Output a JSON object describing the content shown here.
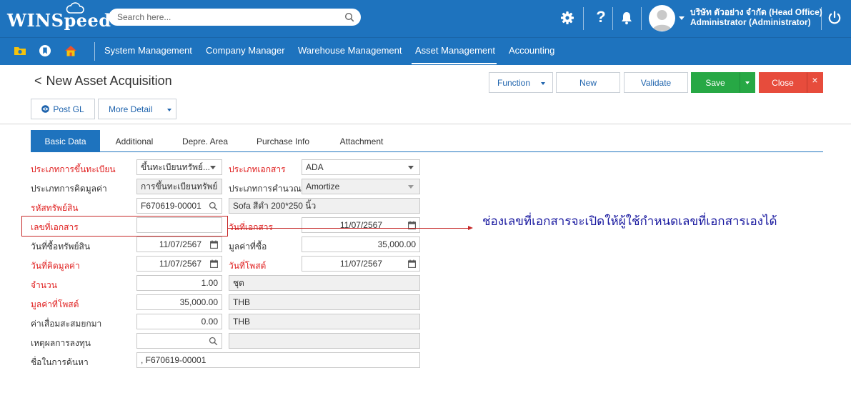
{
  "brand": {
    "logo_text": "WINSpeed",
    "accent": "#1e73be"
  },
  "search": {
    "placeholder": "Search here..."
  },
  "topbar": {
    "icons": [
      "gear-icon",
      "help-icon",
      "bell-icon",
      "user-avatar",
      "power-icon"
    ],
    "help_glyph": "?",
    "company": "บริษัท ตัวอย่าง จำกัด (Head Office)",
    "user": "Administrator (Administrator)"
  },
  "nav": {
    "icons": [
      "folder-icon",
      "bookmark-icon",
      "home-icon"
    ],
    "items": [
      "System Management",
      "Company Manager",
      "Warehouse Management",
      "Asset Management",
      "Accounting"
    ],
    "active": "Asset Management"
  },
  "page": {
    "back_glyph": "<",
    "title": "New Asset Acquisition",
    "buttons": {
      "function": "Function",
      "new": "New",
      "validate": "Validate",
      "save": "Save",
      "close": "Close",
      "close_x": "×",
      "post_gl": "Post GL",
      "more_detail": "More Detail"
    },
    "colors": {
      "save": "#27a845",
      "close": "#e74c3c"
    }
  },
  "tabs": [
    "Basic Data",
    "Additional",
    "Depre. Area",
    "Purchase Info",
    "Attachment"
  ],
  "active_tab": "Basic Data",
  "form": {
    "reg_type": {
      "label": "ประเภทการขึ้นทะเบียน",
      "value": "ขึ้นทะเบียนทรัพย์..."
    },
    "doc_type": {
      "label": "ประเภทเอกสาร",
      "value": "ADA"
    },
    "calc_type": {
      "label": "ประเภทการคิดมูลค่า",
      "value": "การขึ้นทะเบียนทรัพย์สิ"
    },
    "compute_type": {
      "label": "ประเภทการคำนวณ",
      "value": "Amortize"
    },
    "asset_code": {
      "label": "รหัสทรัพย์สิน",
      "value": "F670619-00001"
    },
    "asset_name": {
      "value": "Sofa สีดำ 200*250 นิ้ว"
    },
    "doc_no": {
      "label": "เลขที่เอกสาร",
      "value": ""
    },
    "doc_date": {
      "label": "วันที่เอกสาร",
      "value": "11/07/2567"
    },
    "purchase_date": {
      "label": "วันที่ซื้อทรัพย์สิน",
      "value": "11/07/2567"
    },
    "purchase_value": {
      "label": "มูลค่าที่ซื้อ",
      "value": "35,000.00"
    },
    "calc_date": {
      "label": "วันที่คิดมูลค่า",
      "value": "11/07/2567"
    },
    "post_date": {
      "label": "วันที่โพสต์",
      "value": "11/07/2567"
    },
    "quantity": {
      "label": "จำนวน",
      "value": "1.00",
      "unit": "ชุด"
    },
    "post_value": {
      "label": "มูลค่าที่โพสต์",
      "value": "35,000.00",
      "currency": "THB"
    },
    "accum_depr": {
      "label": "ค่าเสื่อมสะสมยกมา",
      "value": "0.00",
      "currency": "THB"
    },
    "invest_reason": {
      "label": "เหตุผลการลงทุน",
      "value": "",
      "desc": ""
    },
    "search_name": {
      "label": "ชื่อในการค้นหา",
      "value": ", F670619-00001"
    }
  },
  "annotation": {
    "text": "ช่องเลขที่เอกสารจะเปิดให้ผู้ใช้กำหนดเลขที่เอกสารเองได้",
    "color": "#1a1aa0",
    "box_color": "#c62828"
  }
}
